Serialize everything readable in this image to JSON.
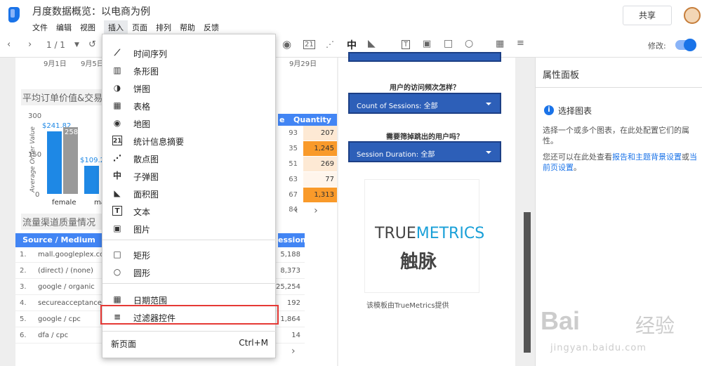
{
  "app": {
    "doc_title": "月度数据概览：以电商为例",
    "share_label": "共享"
  },
  "menu_bar": [
    "文件",
    "编辑",
    "视图",
    "插入",
    "页面",
    "排列",
    "帮助",
    "反馈"
  ],
  "toolbar": {
    "page_indicator": "1 / 1",
    "edit_label": "修改:"
  },
  "insert_menu": {
    "items": [
      {
        "label": "时间序列",
        "icon": "timeseries-icon"
      },
      {
        "label": "条形图",
        "icon": "bar-chart-icon"
      },
      {
        "label": "饼图",
        "icon": "pie-chart-icon"
      },
      {
        "label": "表格",
        "icon": "table-icon"
      },
      {
        "label": "地图",
        "icon": "globe-icon"
      },
      {
        "label": "统计信息摘要",
        "icon": "scorecard-icon"
      },
      {
        "label": "散点图",
        "icon": "scatter-icon"
      },
      {
        "label": "子弹图",
        "icon": "bullet-icon"
      },
      {
        "label": "面积图",
        "icon": "area-chart-icon"
      },
      {
        "label": "文本",
        "icon": "text-icon"
      },
      {
        "label": "图片",
        "icon": "image-icon"
      },
      {
        "label": "矩形",
        "icon": "rectangle-icon"
      },
      {
        "label": "圆形",
        "icon": "circle-icon"
      },
      {
        "label": "日期范围",
        "icon": "calendar-icon"
      },
      {
        "label": "过滤器控件",
        "icon": "filter-icon"
      },
      {
        "label": "新页面",
        "icon": ""
      }
    ],
    "new_page_shortcut": "Ctrl+M"
  },
  "left_page": {
    "dates": [
      "9月1日",
      "9月5日",
      "9月29日"
    ],
    "aov_title": "平均订单价值&交易",
    "y_axis_label": "Average Order Value",
    "y_ticks": [
      "300",
      "150",
      "0"
    ],
    "bar_labels": [
      "$241.82",
      "258",
      "$109.2"
    ],
    "categories": [
      "female",
      "ma"
    ],
    "qty_header": "Quantity",
    "qty_header_left": "e",
    "qty_rows": [
      {
        "left": "93",
        "value": "207",
        "color": "#fde9d4"
      },
      {
        "left": "35",
        "value": "1,245",
        "color": "#f99a2a"
      },
      {
        "left": "51",
        "value": "269",
        "color": "#fde9d4"
      },
      {
        "left": "63",
        "value": "77",
        "color": "#fff5ec"
      },
      {
        "left": "67",
        "value": "1,313",
        "color": "#f99a2a"
      }
    ],
    "qty_extra_left": "84",
    "traffic_title": "流量渠道质量情况",
    "src_header": "Source / Medium",
    "sessions_header": "essions",
    "src_rows": [
      {
        "idx": "1.",
        "name": "mall.googleplex.co...",
        "val": "5,188"
      },
      {
        "idx": "2.",
        "name": "(direct) / (none)",
        "val": "8,373"
      },
      {
        "idx": "3.",
        "name": "google / organic",
        "val": "25,254"
      },
      {
        "idx": "4.",
        "name": "secureacceptance...",
        "val": "192"
      },
      {
        "idx": "5.",
        "name": "google / cpc",
        "val": "1,864"
      },
      {
        "idx": "6.",
        "name": "dfa / cpc",
        "val": "14"
      }
    ]
  },
  "right_page": {
    "q1": "用户的访问频次怎样？",
    "dd1": "Count of Sessions: 全部",
    "q2": "需要筛掉跳出的用户吗？",
    "dd2": "Session Duration: 全部",
    "logo_true": "TRUE",
    "logo_metrics": "METRICS",
    "logo_cn": "触脉",
    "credit": "该模板由TrueMetrics提供"
  },
  "prop_panel": {
    "title": "属性面板",
    "select_title": "选择图表",
    "desc": "选择一个或多个图表，在此处配置它们的属性。",
    "more_prefix": "您还可以在此处查看",
    "link1": "报告和主题背景设置",
    "more_mid": "或",
    "link2": "当前页设置",
    "more_suffix": "。"
  },
  "watermark": {
    "bai": "Bai",
    "cn": "经验",
    "url": "jingyan.baidu.com"
  },
  "chart_data": {
    "type": "bar",
    "categories": [
      "female",
      "ma"
    ],
    "series": [
      {
        "values": [
          241.82,
          109.2
        ]
      },
      {
        "values": [
          258,
          null
        ]
      }
    ],
    "ylabel": "Average Order Value",
    "ylim": [
      0,
      300
    ]
  }
}
